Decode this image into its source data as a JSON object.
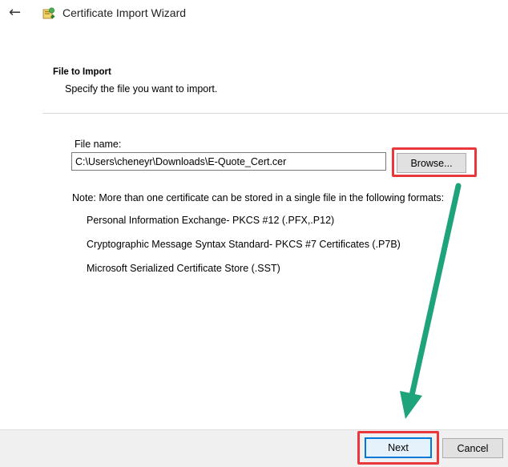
{
  "window": {
    "back_icon": "back-arrow-icon",
    "app_icon": "certificate-wizard-icon",
    "title": "Certificate Import Wizard"
  },
  "page": {
    "heading": "File to Import",
    "subtitle": "Specify the file you want to import."
  },
  "file": {
    "label": "File name:",
    "value": "C:\\Users\\cheneyr\\Downloads\\E-Quote_Cert.cer",
    "browse_label": "Browse..."
  },
  "note": {
    "text": "Note:  More than one certificate can be stored in a single file in the following formats:",
    "formats": [
      "Personal Information Exchange- PKCS #12 (.PFX,.P12)",
      "Cryptographic Message Syntax Standard- PKCS #7 Certificates (.P7B)",
      "Microsoft Serialized Certificate Store (.SST)"
    ]
  },
  "footer": {
    "next_label": "Next",
    "cancel_label": "Cancel"
  },
  "annotations": {
    "highlight_color": "#e8383d",
    "arrow_color": "#1fa37a"
  },
  "colors": {
    "default_button_border": "#0078d7",
    "default_button_bg": "#e5f1fb",
    "footer_bg": "#f0f0f0"
  }
}
